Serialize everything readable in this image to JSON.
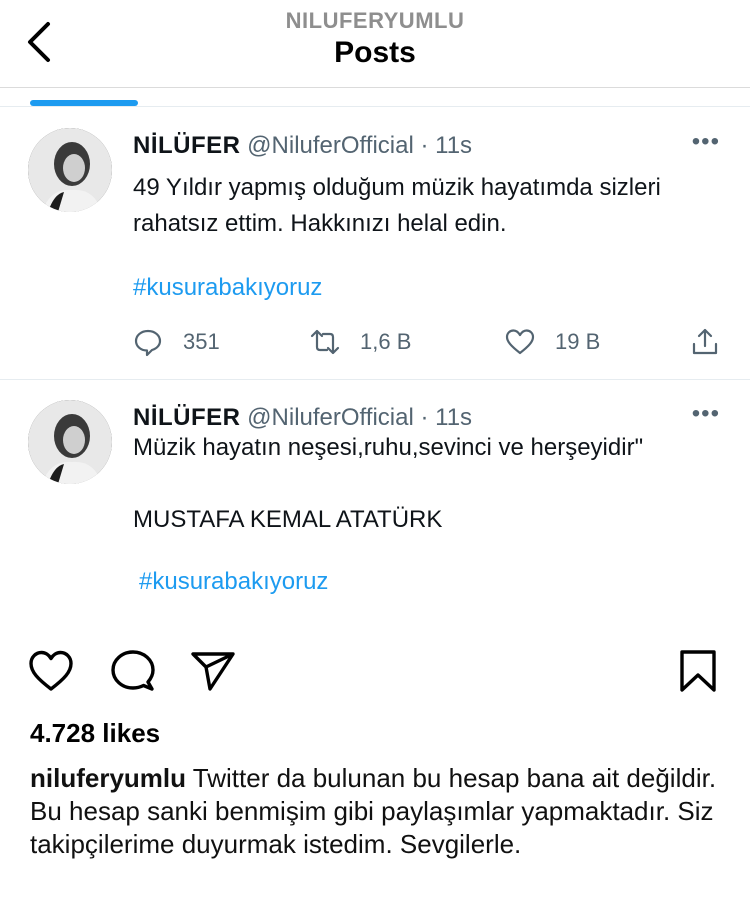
{
  "header": {
    "username": "NILUFERYUMLU",
    "title": "Posts",
    "back_icon": "chevron-left-icon"
  },
  "tweets": [
    {
      "name": "NİLÜFER",
      "handle": "@NiluferOfficial",
      "time": "· 11s",
      "more": "•••",
      "text_lines": [
        "49 Yıldır yapmış olduğum müzik hayatımda  sizleri",
        "rahatsız ettim. Hakkınızı helal edin."
      ],
      "hashtag": "#kusurabakıyoruz",
      "replies": "351",
      "retweets": "1,6 B",
      "likes": "19 B"
    },
    {
      "name": "NİLÜFER",
      "handle": "@NiluferOfficial",
      "time": "· 11s",
      "more": "•••",
      "text_lines": [
        "Müzik hayatın neşesi,ruhu,sevinci ve herşeyidir\"",
        "",
        "MUSTAFA KEMAL ATATÜRK"
      ],
      "hashtag": "#kusurabakıyoruz"
    }
  ],
  "post": {
    "likes": "4.728 likes",
    "caption_user": "niluferyumlu",
    "caption_text": "Twitter da bulunan bu hesap bana ait değildir. Bu hesap sanki benmişim gibi paylaşımlar yapmaktadır. Siz takipçilerime duyurmak istedim. Sevgilerle."
  },
  "colors": {
    "twitter_blue": "#1d9bf0",
    "muted": "#536471",
    "ig_muted": "#8e8e8e"
  }
}
